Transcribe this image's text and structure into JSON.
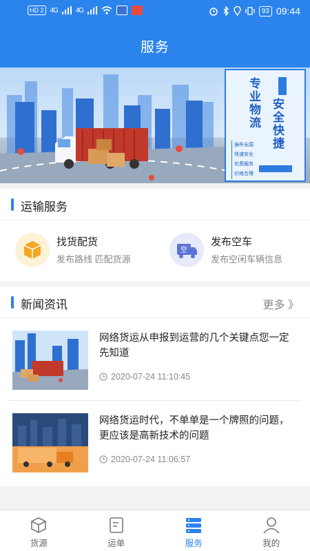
{
  "status_bar": {
    "network_tag": "HD 2",
    "signal1": "4G",
    "signal2": "4G",
    "battery": "93",
    "time": "09:44"
  },
  "header": {
    "title": "服务"
  },
  "banner": {
    "poster_title_1": "专业物流",
    "poster_title_2": "安全快捷",
    "poster_list": [
      "遍布全国",
      "快速安全",
      "优质服务",
      "价格合理"
    ]
  },
  "transport": {
    "title": "运输服务",
    "items": [
      {
        "name": "找货配货",
        "desc": "发布路线  匹配货源",
        "icon": "package-icon"
      },
      {
        "name": "发布空车",
        "desc": "发布空闲车辆信息",
        "icon": "empty-truck-icon",
        "badge": "空"
      }
    ]
  },
  "news": {
    "title": "新闻资讯",
    "more": "更多 》",
    "items": [
      {
        "title": "网络货运从申报到运营的几个关键点您一定先知道",
        "date": "2020-07-24 11:10:45"
      },
      {
        "title": "网络货运时代，不单单是一个牌照的问题，更应该是高新技术的问题",
        "date": "2020-07-24 11:06:57"
      }
    ]
  },
  "tabbar": {
    "active": "服务",
    "tabs": [
      {
        "label": "货源",
        "icon": "box-icon"
      },
      {
        "label": "运单",
        "icon": "waybill-icon"
      },
      {
        "label": "服务",
        "icon": "service-icon"
      },
      {
        "label": "我的",
        "icon": "user-icon"
      }
    ]
  },
  "colors": {
    "primary": "#2b83ec",
    "service_icon_1_bg": "#fdf1d6",
    "service_icon_2_bg": "#e6eafb"
  }
}
